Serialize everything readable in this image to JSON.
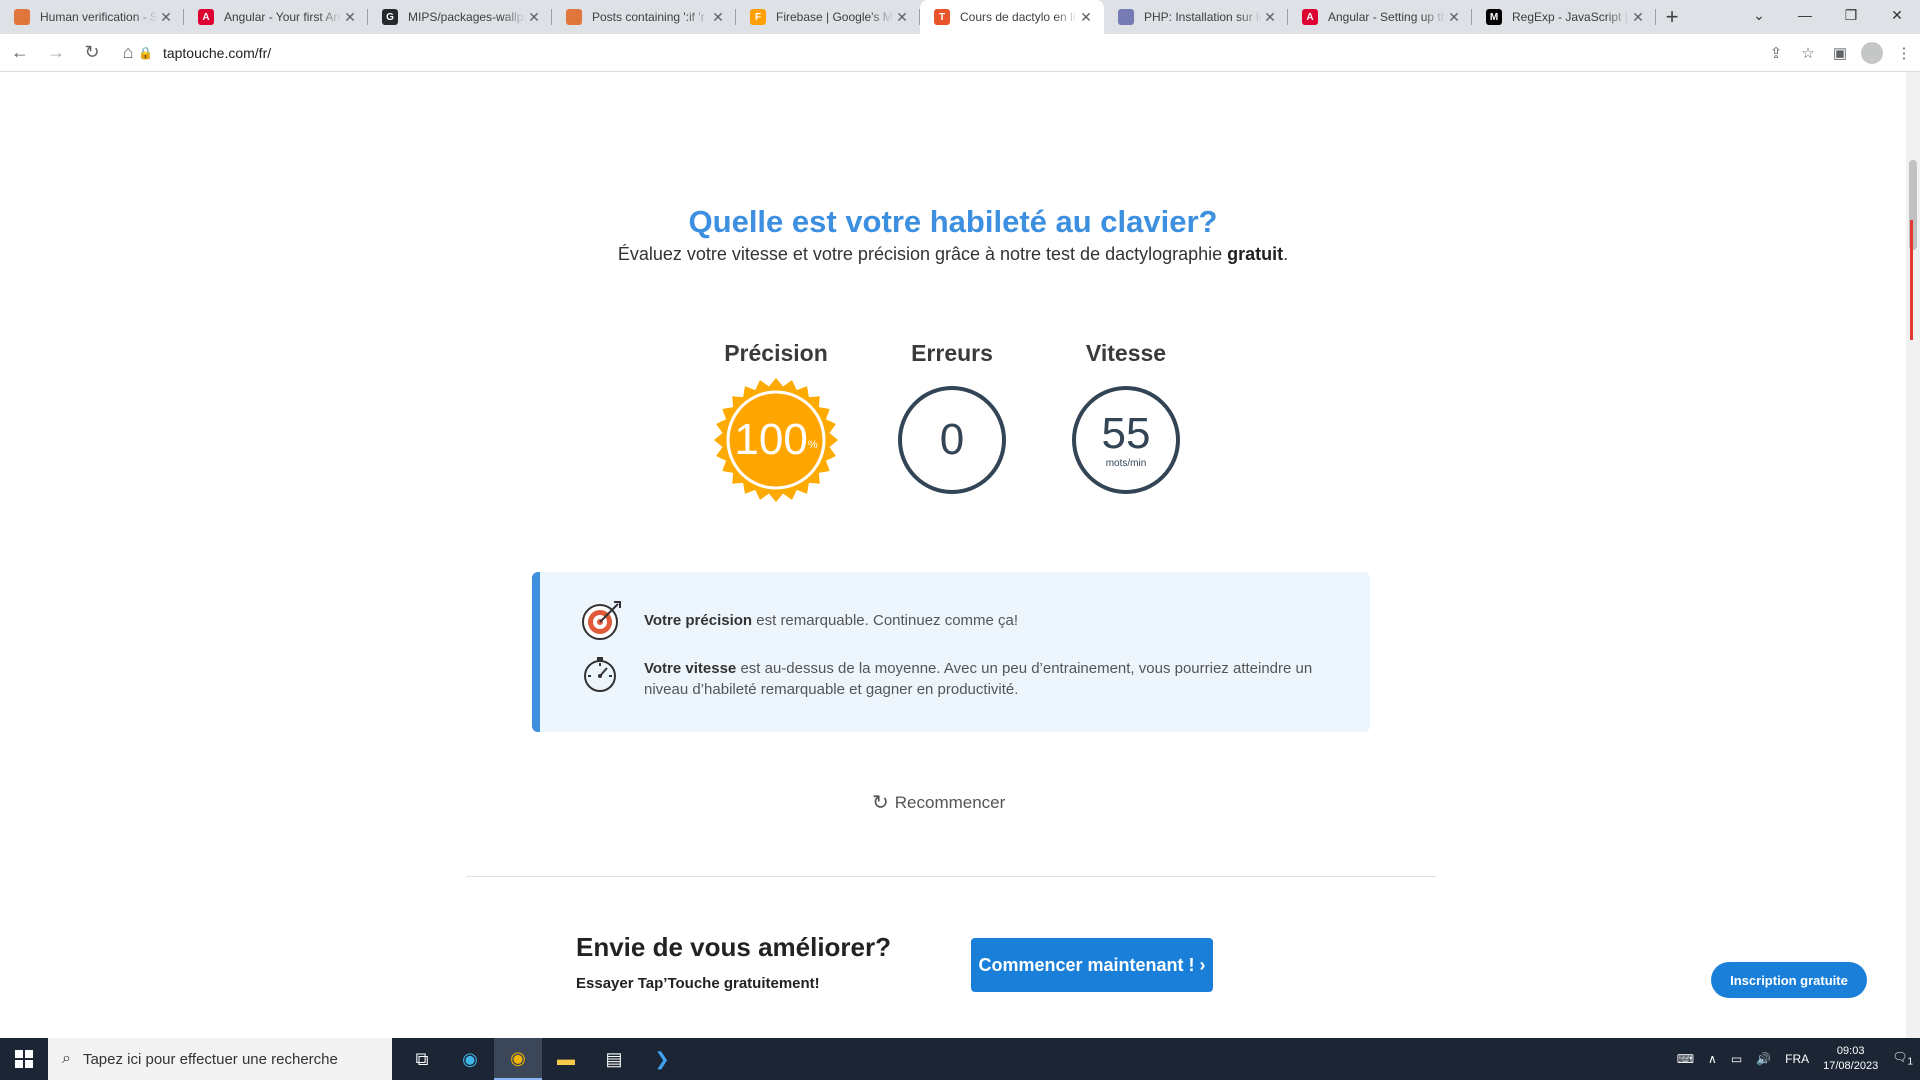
{
  "browser": {
    "tabs": [
      {
        "title": "Human verification - S",
        "favicon": "flame",
        "color": "#e0763c"
      },
      {
        "title": "Angular - Your first An",
        "favicon": "A",
        "color": "#dd0031"
      },
      {
        "title": "MIPS/packages-wallpa",
        "favicon": "gh",
        "color": "#24292e"
      },
      {
        "title": "Posts containing ':if 'r",
        "favicon": "flame",
        "color": "#e0763c"
      },
      {
        "title": "Firebase | Google's Mo",
        "favicon": "fb",
        "color": "#ffa000"
      },
      {
        "title": "Cours de dactylo en li",
        "favicon": "T",
        "color": "#e8552b"
      },
      {
        "title": "PHP: Installation sur le",
        "favicon": "php",
        "color": "#777bb3"
      },
      {
        "title": "Angular - Setting up th",
        "favicon": "A",
        "color": "#dd0031"
      },
      {
        "title": "RegExp - JavaScript | M",
        "favicon": "M",
        "color": "#000000"
      }
    ],
    "active_tab": 5,
    "url": "taptouche.com/fr/"
  },
  "page": {
    "headline": "Quelle est votre habileté au clavier?",
    "subline_prefix": "Évaluez votre vitesse et votre précision grâce à notre test de dactylographie ",
    "subline_bold": "gratuit",
    "subline_suffix": ".",
    "stats": {
      "precision_label": "Précision",
      "precision_value": "100",
      "precision_unit": "%",
      "errors_label": "Erreurs",
      "errors_value": "0",
      "speed_label": "Vitesse",
      "speed_value": "55",
      "speed_unit": "mots/min"
    },
    "feedback": {
      "precision_bold": "Votre précision",
      "precision_text": " est remarquable. Continuez comme ça!",
      "speed_bold": "Votre vitesse",
      "speed_text": " est au-dessus de la moyenne. Avec un peu d’entrainement, vous pourriez atteindre un niveau d’habileté remarquable et gagner en productivité."
    },
    "restart_label": "Recommencer",
    "promo_title": "Envie de vous améliorer?",
    "promo_sub": "Essayer Tap’Touche gratuitement!",
    "cta_label": "Commencer maintenant ! ›",
    "signup_label": "Inscription gratuite"
  },
  "taskbar": {
    "search_placeholder": "Tapez ici pour effectuer une recherche",
    "language": "FRA",
    "time": "09:03",
    "date": "17/08/2023",
    "notifications": "1"
  },
  "colors": {
    "accent": "#3d8fe0",
    "button": "#1a7fd8",
    "badge": "#ffaa00"
  }
}
